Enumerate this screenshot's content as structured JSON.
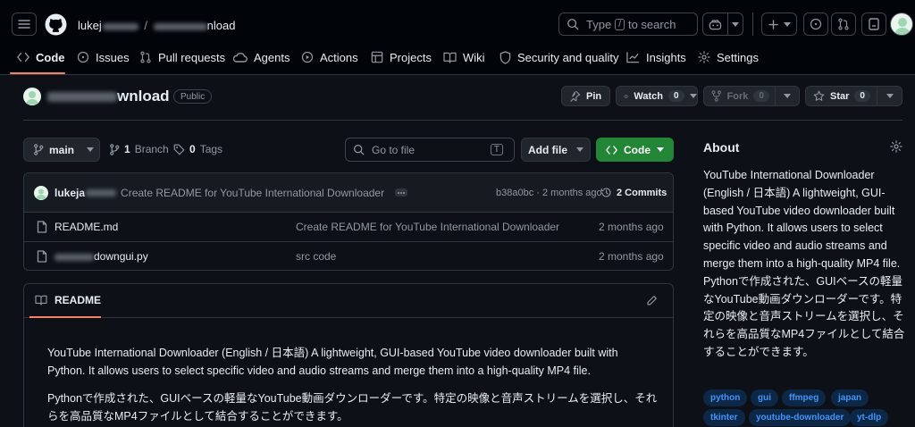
{
  "header": {
    "owner_suffix": "lukej",
    "repo_suffix": "nload",
    "search_type": "Type",
    "search_key": "/",
    "search_rest": "to search"
  },
  "nav": {
    "items": [
      {
        "label": "Code",
        "icon": "code-icon"
      },
      {
        "label": "Issues",
        "icon": "issue-icon"
      },
      {
        "label": "Pull requests",
        "icon": "pull-request-icon"
      },
      {
        "label": "Agents",
        "icon": "agents-icon"
      },
      {
        "label": "Actions",
        "icon": "play-icon"
      },
      {
        "label": "Projects",
        "icon": "table-icon"
      },
      {
        "label": "Wiki",
        "icon": "book-icon"
      },
      {
        "label": "Security and quality",
        "icon": "shield-icon"
      },
      {
        "label": "Insights",
        "icon": "graph-icon"
      },
      {
        "label": "Settings",
        "icon": "gear-icon"
      }
    ]
  },
  "repo": {
    "name_suffix": "wnload",
    "visibility": "Public",
    "pin_label": "Pin",
    "watch_label": "Watch",
    "watch_count": "0",
    "fork_label": "Fork",
    "fork_count": "0",
    "star_label": "Star",
    "star_count": "0"
  },
  "toolbar": {
    "branch": "main",
    "branch_count": "1",
    "branch_label": "Branch",
    "tag_count": "0",
    "tag_label": "Tags",
    "goto_placeholder": "Go to file",
    "goto_key": "T",
    "add_file": "Add file",
    "code": "Code"
  },
  "commit": {
    "author": "lukeja",
    "message": "Create README for YouTube International Downloader",
    "hash": "b38a0bc",
    "age": "· 2 months ago",
    "commits_label": "2 Commits"
  },
  "files": [
    {
      "name": "README.md",
      "message": "Create README for YouTube International Downloader",
      "age": "2 months ago"
    },
    {
      "name": "downgui.py",
      "message": "src code",
      "age": "2 months ago"
    }
  ],
  "readme": {
    "tab": "README",
    "paragraph1": "YouTube International Downloader (English / 日本語) A lightweight, GUI-based YouTube video downloader built with Python. It allows users to select specific video and audio streams and merge them into a high-quality MP4 file.",
    "paragraph2": "Pythonで作成された、GUIベースの軽量なYouTube動画ダウンローダーです。特定の映像と音声ストリームを選択し、それらを高品質なMP4ファイルとして結合することができます。"
  },
  "about": {
    "title": "About",
    "description": "YouTube International Downloader (English / 日本語) A lightweight, GUI-based YouTube video downloader built with Python. It allows users to select specific video and audio streams and merge them into a high-quality MP4 file. Pythonで作成された、GUIベースの軽量なYouTube動画ダウンローダーです。特定の映像と音声ストリームを選択し、それらを高品質なMP4ファイルとして結合することができます。",
    "topics": [
      "python",
      "gui",
      "ffmpeg",
      "japan",
      "tkinter",
      "youtube-downloader",
      "yt-dlp"
    ]
  },
  "colors": {
    "accent_underline": "#f78166",
    "code_button": "#238636",
    "link": "#4493f8",
    "topic_bg": "#0d2847"
  }
}
